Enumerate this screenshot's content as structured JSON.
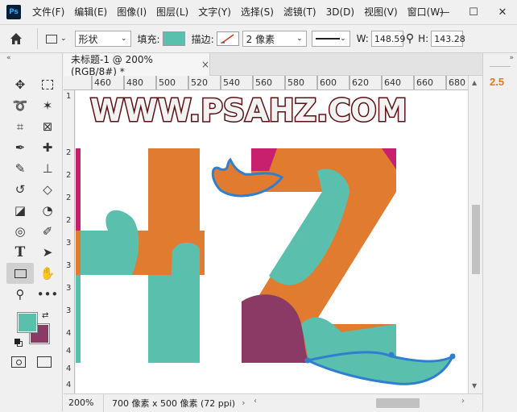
{
  "app": {
    "logo": "Ps"
  },
  "menu": [
    "文件(F)",
    "编辑(E)",
    "图像(I)",
    "图层(L)",
    "文字(Y)",
    "选择(S)",
    "滤镜(T)",
    "3D(D)",
    "视图(V)",
    "窗口(W)"
  ],
  "window_controls": {
    "minimize": "—",
    "maximize": "☐",
    "close": "✕"
  },
  "options": {
    "mode": "形状",
    "fill_label": "填充:",
    "fill_color": "#5bbfae",
    "stroke_label": "描边:",
    "stroke_width": "2 像素",
    "w_label": "W:",
    "w_value": "148.59",
    "h_label": "H:",
    "h_value": "143.28"
  },
  "tab": {
    "title": "未标题-1 @ 200%(RGB/8#) *",
    "close": "×"
  },
  "ruler": {
    "top": [
      "460",
      "480",
      "500",
      "520",
      "540",
      "560",
      "580",
      "600",
      "620",
      "640",
      "660",
      "680"
    ],
    "left": [
      "1",
      "2",
      "2",
      "2",
      "2",
      "3",
      "3",
      "3",
      "3",
      "4",
      "4",
      "4",
      "4"
    ]
  },
  "canvas": {
    "headline": "WWW.PSAHZ.COM",
    "colors": {
      "orange": "#e07b30",
      "teal": "#5bbfae",
      "magenta": "#c91f6f",
      "plum": "#8a3a64",
      "stroke": "#2f7fd0",
      "headline": "#f2f2f2",
      "headline_outline": "#5a1010"
    }
  },
  "colors": {
    "foreground": "#5bbfae",
    "background": "#8a3a64"
  },
  "status": {
    "zoom": "200%",
    "doc_info": "700 像素 x 500 像素 (72 ppi)"
  },
  "right_panel": {
    "version": "2.5"
  }
}
